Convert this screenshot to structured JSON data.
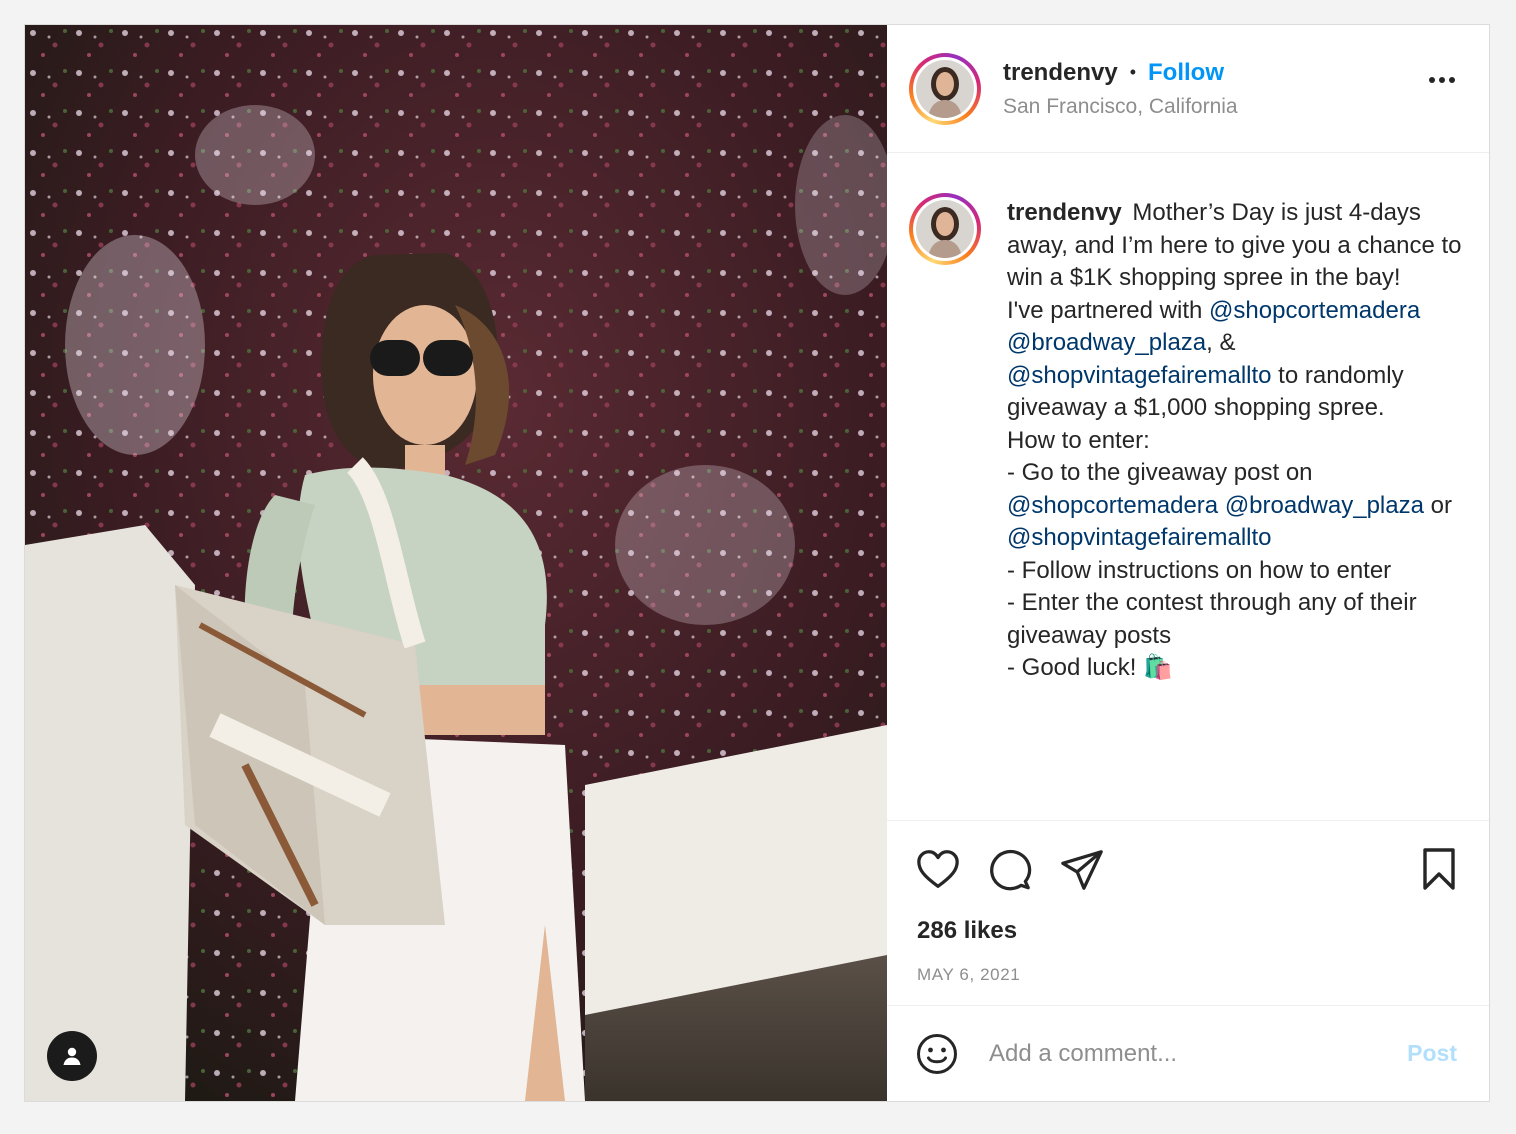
{
  "header": {
    "username": "trendenvy",
    "separator": "•",
    "follow_label": "Follow",
    "location": "San Francisco, California"
  },
  "caption": {
    "username": "trendenvy",
    "p1": "Mother’s Day is just 4-days away, and I’m here to give you a chance to win a $1K shopping spree in the bay!",
    "p2_a": "I've partnered with ",
    "p2_m1": "@shopcortemadera",
    "p2_m2": "@broadway_plaza",
    "p2_b": ", & ",
    "p2_m3": "@shopvintagefairemallto",
    "p2_c": " to randomly giveaway a $1,000 shopping spree.",
    "p3_title": "How to enter:",
    "p3_l1": "- Go to the giveaway post on ",
    "p3_m1": "@shopcortemadera",
    "p3_m2": "@broadway_plaza",
    "p3_or": " or ",
    "p3_m3": "@shopvintagefairemallto",
    "p3_l2": "- Follow instructions on how to enter",
    "p3_l3": "- Enter the contest through any of their giveaway posts",
    "p3_l4": "- Good luck! 🛍️"
  },
  "stats": {
    "likes": "286 likes",
    "date": "MAY 6, 2021"
  },
  "comment": {
    "placeholder": "Add a comment...",
    "post_label": "Post"
  },
  "colors": {
    "follow": "#0095f6",
    "mention": "#00376b",
    "post_disabled": "#b2dffc"
  },
  "icons": [
    "heart-icon",
    "comment-icon",
    "share-icon",
    "bookmark-icon",
    "emoji-icon",
    "user-tag-icon",
    "more-icon"
  ]
}
